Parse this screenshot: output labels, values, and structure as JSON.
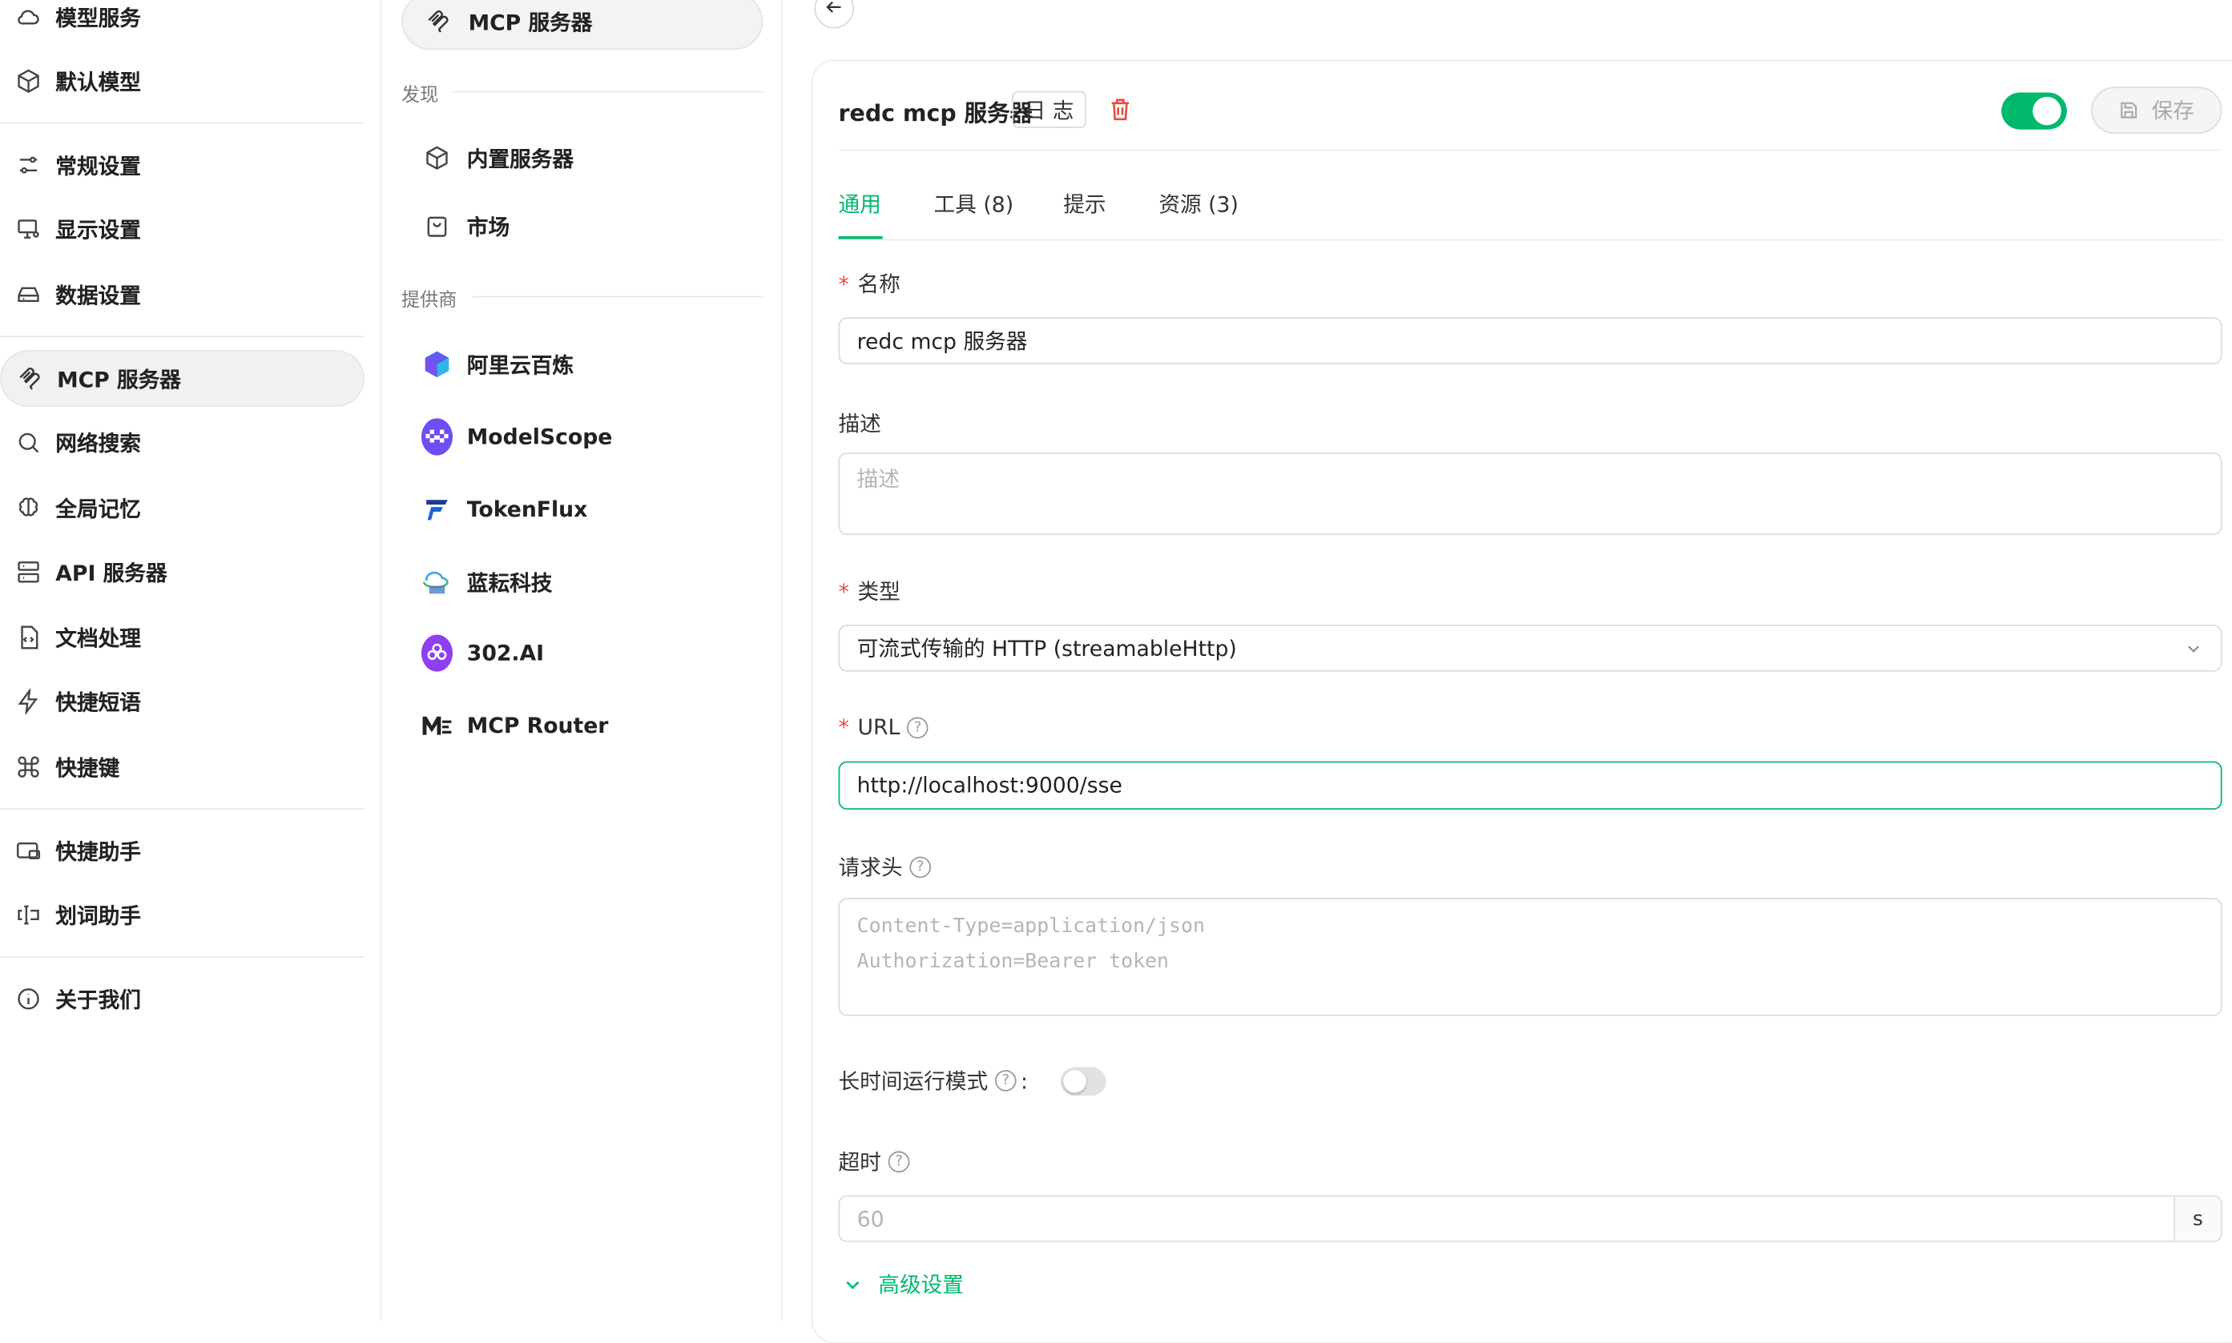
{
  "sidebar": {
    "items": [
      {
        "label": "模型服务",
        "icon": "cloud-icon"
      },
      {
        "label": "默认模型",
        "icon": "cube-icon"
      },
      {
        "label": "常规设置",
        "icon": "settings-sliders-icon"
      },
      {
        "label": "显示设置",
        "icon": "monitor-icon"
      },
      {
        "label": "数据设置",
        "icon": "hard-drive-icon"
      },
      {
        "label": "MCP 服务器",
        "icon": "mcp-icon"
      },
      {
        "label": "网络搜索",
        "icon": "search-icon"
      },
      {
        "label": "全局记忆",
        "icon": "brain-icon"
      },
      {
        "label": "API 服务器",
        "icon": "server-icon"
      },
      {
        "label": "文档处理",
        "icon": "document-code-icon"
      },
      {
        "label": "快捷短语",
        "icon": "lightning-icon"
      },
      {
        "label": "快捷键",
        "icon": "command-icon"
      },
      {
        "label": "快捷助手",
        "icon": "window-icon"
      },
      {
        "label": "划词助手",
        "icon": "text-cursor-icon"
      },
      {
        "label": "关于我们",
        "icon": "info-icon"
      }
    ],
    "active_index": 5
  },
  "mcp_list": {
    "top_item": "MCP 服务器",
    "discover_heading": "发现",
    "discover_items": [
      {
        "label": "内置服务器",
        "icon": "cube-icon"
      },
      {
        "label": "市场",
        "icon": "shopping-bag-icon"
      }
    ],
    "providers_heading": "提供商",
    "providers": [
      {
        "label": "阿里云百炼"
      },
      {
        "label": "ModelScope"
      },
      {
        "label": "TokenFlux"
      },
      {
        "label": "蓝耘科技"
      },
      {
        "label": "302.AI"
      },
      {
        "label": "MCP Router"
      }
    ]
  },
  "server": {
    "title": "redc mcp 服务器",
    "logs_button": "日 志",
    "enabled": true,
    "save_button": "保存",
    "tabs": [
      "通用",
      "工具 (8)",
      "提示",
      "资源 (3)"
    ],
    "active_tab": 0,
    "name_label": "名称",
    "name_value": "redc mcp 服务器",
    "description_label": "描述",
    "description_placeholder": "描述",
    "type_label": "类型",
    "type_value": "可流式传输的 HTTP (streamableHttp)",
    "url_label": "URL",
    "url_value": "http://localhost:9000/sse",
    "headers_label": "请求头",
    "headers_placeholder_line1": "Content-Type=application/json",
    "headers_placeholder_line2": "Authorization=Bearer token",
    "long_running_label": "长时间运行模式",
    "long_running_colon": ":",
    "long_running_enabled": false,
    "timeout_label": "超时",
    "timeout_placeholder": "60",
    "timeout_unit": "s",
    "advanced_label": "高级设置"
  },
  "colors": {
    "accent": "#00b96b",
    "danger": "#e54d42",
    "active_bg": "#f1f1f1"
  }
}
